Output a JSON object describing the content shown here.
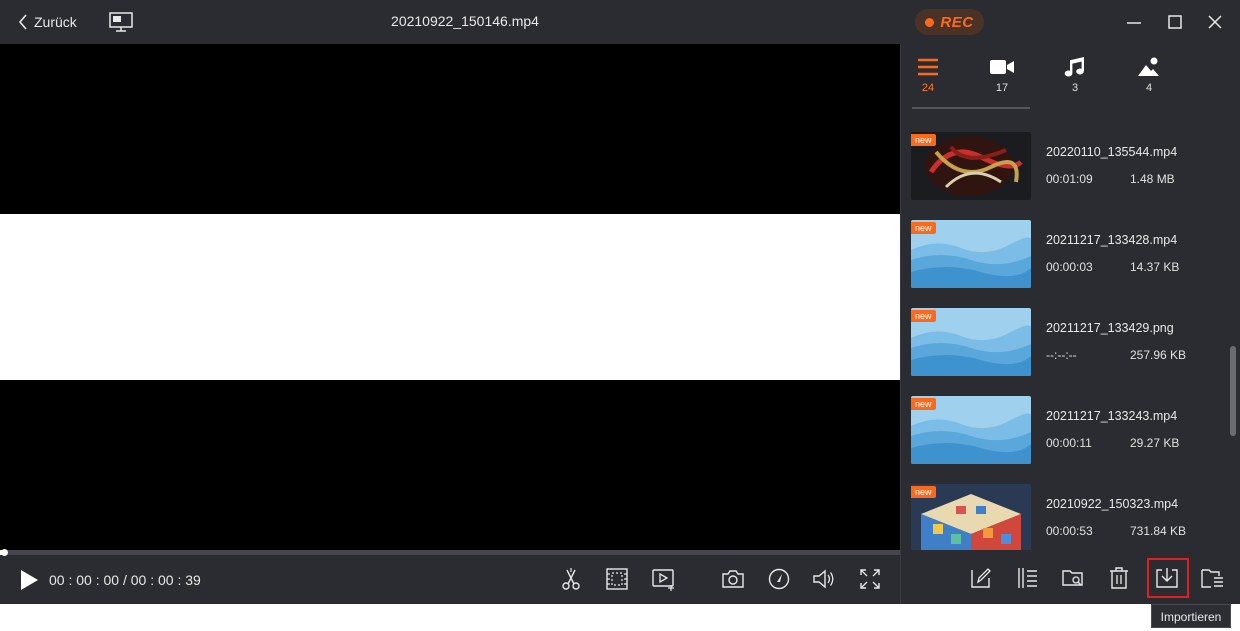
{
  "titlebar": {
    "back_label": "Zurück",
    "file_title": "20210922_150146.mp4",
    "rec_label": "REC"
  },
  "player": {
    "current_time": "00 : 00 : 00",
    "separator": " / ",
    "total_time": "00 : 00 : 39",
    "progress_fraction": 0.004
  },
  "categories": [
    {
      "icon": "list-icon",
      "count": "24",
      "active": true
    },
    {
      "icon": "video-camera-icon",
      "count": "17",
      "active": false
    },
    {
      "icon": "music-note-icon",
      "count": "3",
      "active": false
    },
    {
      "icon": "image-icon",
      "count": "4",
      "active": false
    }
  ],
  "files": [
    {
      "name": "20220110_135544.mp4",
      "duration": "00:01:09",
      "size": "1.48 MB",
      "badge": "new",
      "thumb": "dark-art"
    },
    {
      "name": "20211217_133428.mp4",
      "duration": "00:00:03",
      "size": "14.37 KB",
      "badge": "new",
      "thumb": "blue-mountains"
    },
    {
      "name": "20211217_133429.png",
      "duration": "--:--:--",
      "size": "257.96 KB",
      "badge": "new",
      "thumb": "blue-mountains"
    },
    {
      "name": "20211217_133243.mp4",
      "duration": "00:00:11",
      "size": "29.27 KB",
      "badge": "new",
      "thumb": "blue-mountains"
    },
    {
      "name": "20210922_150323.mp4",
      "duration": "00:00:53",
      "size": "731.84 KB",
      "badge": "new",
      "thumb": "colorful-cube"
    }
  ],
  "tooltip": "Importieren",
  "colors": {
    "accent": "#ff6a1a",
    "background": "#2b2c31",
    "highlight": "#e02020"
  }
}
